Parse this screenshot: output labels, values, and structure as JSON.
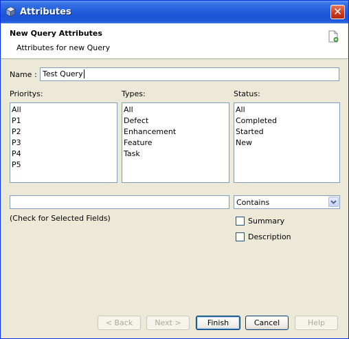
{
  "window": {
    "title": "Attributes",
    "close_glyph": "✕"
  },
  "header": {
    "title": "New Query Attributes",
    "subtitle": "Attributes for new Query"
  },
  "name_field": {
    "label": "Name :",
    "value": "Test Query"
  },
  "priorities": {
    "label": "Prioritys:",
    "items": [
      "All",
      "P1",
      "P2",
      "P3",
      "P4",
      "P5"
    ]
  },
  "types": {
    "label": "Types:",
    "items": [
      "All",
      "Defect",
      "Enhancement",
      "Feature",
      "Task"
    ]
  },
  "status": {
    "label": "Status:",
    "items": [
      "All",
      "Completed",
      "Started",
      "New"
    ]
  },
  "search": {
    "value": "",
    "hint": "(Check for Selected Fields)",
    "match_mode": "Contains"
  },
  "fields": {
    "summary_label": "Summary",
    "description_label": "Description"
  },
  "buttons": {
    "back": "< Back",
    "next": "Next >",
    "finish": "Finish",
    "cancel": "Cancel",
    "help": "Help"
  }
}
